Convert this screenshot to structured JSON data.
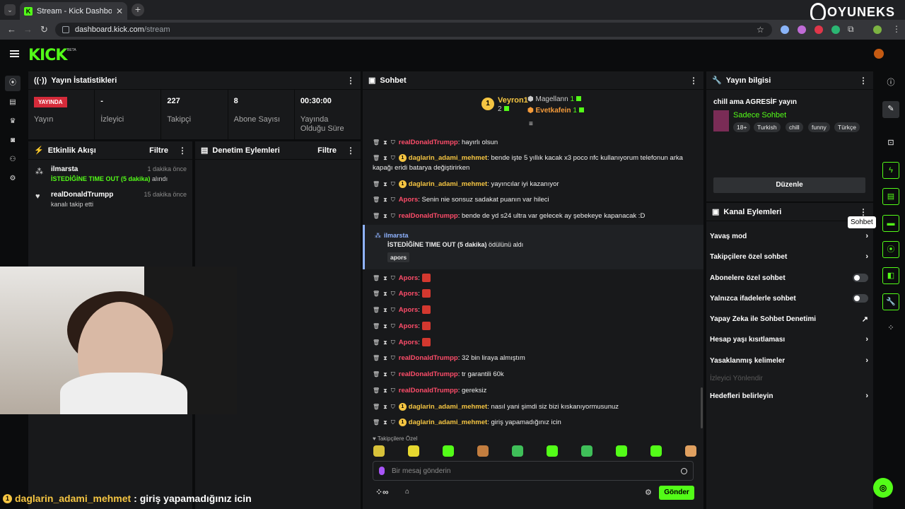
{
  "browser": {
    "tab_title": "Stream - Kick Dashboard",
    "url_domain": "dashboard.kick.com",
    "url_path": "/stream",
    "watermark": "OYUNEKS"
  },
  "header": {
    "logo": "KICK",
    "beta": "BETA"
  },
  "stats": {
    "title": "Yayın İstatistikleri",
    "items": [
      {
        "value": "YAYINDA",
        "label": "Yayın"
      },
      {
        "value": "-",
        "label": "İzleyici"
      },
      {
        "value": "227",
        "label": "Takipçi"
      },
      {
        "value": "8",
        "label": "Abone Sayısı"
      },
      {
        "value": "00:30:00",
        "label": "Yayında Olduğu Süre"
      }
    ]
  },
  "activity": {
    "title": "Etkinlik Akışı",
    "filter": "Filtre",
    "items": [
      {
        "name": "ilmarsta",
        "time": "1 dakika önce",
        "highlight": "İSTEDİĞİNE TIME OUT (5 dakika)",
        "desc": "alındı"
      },
      {
        "name": "realDonaldTrumpp",
        "time": "15 dakika önce",
        "desc": "kanalı takip etti"
      }
    ]
  },
  "moderation": {
    "title": "Denetim Eylemleri",
    "filter": "Filtre"
  },
  "chat": {
    "title": "Sohbet",
    "podium": {
      "first_name": "Veyron1",
      "first_score": "2",
      "second_name": "Magellann",
      "second_score": "1",
      "third_name": "Evetkafein",
      "third_score": "1"
    },
    "messages": [
      {
        "user": "realDonaldTrumpp",
        "text": ": hayırlı olsun",
        "color": "#ff4d6a"
      },
      {
        "user": "daglarin_adami_mehmet",
        "text": ": bende işte 5 yıllık kacak x3 poco nfc kullanıyorum telefonun arka kapağı eridi batarya değiştirirken",
        "color": "#f5c542"
      },
      {
        "user": "daglarin_adami_mehmet",
        "text": ": yayıncılar iyi kazanıyor",
        "color": "#f5c542"
      },
      {
        "user": "Apors",
        "text": ": Senin nie sonsuz sadakat puanın var hileci",
        "color": "#ff4d6a"
      },
      {
        "user": "realDonaldTrumpp",
        "text": ": bende de yd s24 ultra var gelecek ay şebekeye kapanacak :D",
        "color": "#ff4d6a"
      },
      {
        "user": "Apors",
        "text": ": ",
        "color": "#ff4d6a"
      },
      {
        "user": "Apors",
        "text": ": ",
        "color": "#ff4d6a"
      },
      {
        "user": "Apors",
        "text": ": ",
        "color": "#ff4d6a"
      },
      {
        "user": "Apors",
        "text": ": ",
        "color": "#ff4d6a"
      },
      {
        "user": "Apors",
        "text": ": ",
        "color": "#ff4d6a"
      },
      {
        "user": "realDonaldTrumpp",
        "text": ": 32 bin liraya almıştım",
        "color": "#ff4d6a"
      },
      {
        "user": "realDonaldTrumpp",
        "text": ": tr garantili 60k",
        "color": "#ff4d6a"
      },
      {
        "user": "realDonaldTrumpp",
        "text": ": gereksiz",
        "color": "#ff4d6a"
      },
      {
        "user": "daglarin_adami_mehmet",
        "text": ": nasıl yani şimdi siz bizi kıskanıyormusunuz",
        "color": "#f5c542"
      },
      {
        "user": "daglarin_adami_mehmet",
        "text": ": giriş yapamadığınız icin",
        "color": "#f5c542"
      }
    ],
    "redeem": {
      "user": "ilmarsta",
      "highlight": "İSTEDİĞİNE TIME OUT (5 dakika)",
      "rest": " ödülünü aldı",
      "target": "apors"
    },
    "followers_only": "Takipçilere Özel",
    "input_placeholder": "Bir mesaj gönderin",
    "send": "Gönder"
  },
  "stream_info": {
    "title": "Yayın bilgisi",
    "stream_title": "chill ama AGRESİF yayın",
    "category": "Sadece Sohbet",
    "tags": [
      "18+",
      "Turkish",
      "chill",
      "funny",
      "Türkçe"
    ],
    "edit": "Düzenle"
  },
  "channel_actions": {
    "title": "Kanal Eylemleri",
    "items": [
      {
        "label": "Yavaş mod"
      },
      {
        "label": "Takipçilere özel sohbet"
      },
      {
        "label": "Abonelere özel sohbet"
      },
      {
        "label": "Yalnızca ifadelerle sohbet"
      },
      {
        "label": "Yapay Zeka ile Sohbet Denetimi"
      },
      {
        "label": "Hesap yaşı kısıtlaması"
      },
      {
        "label": "Yasaklanmış kelimeler"
      },
      {
        "label": "İzleyici Yönlendir"
      },
      {
        "label": "Hedefleri belirleyin"
      }
    ]
  },
  "right_rail": {
    "tooltip": "Sohbet"
  },
  "subtitle": {
    "user": "daglarin_adami_mehmet",
    "text": ": giriş yapamadığınız icin"
  },
  "colors": {
    "accent": "#53fc18",
    "live": "#d52b3a",
    "panel": "#18191b",
    "bg": "#0b0c0d"
  }
}
